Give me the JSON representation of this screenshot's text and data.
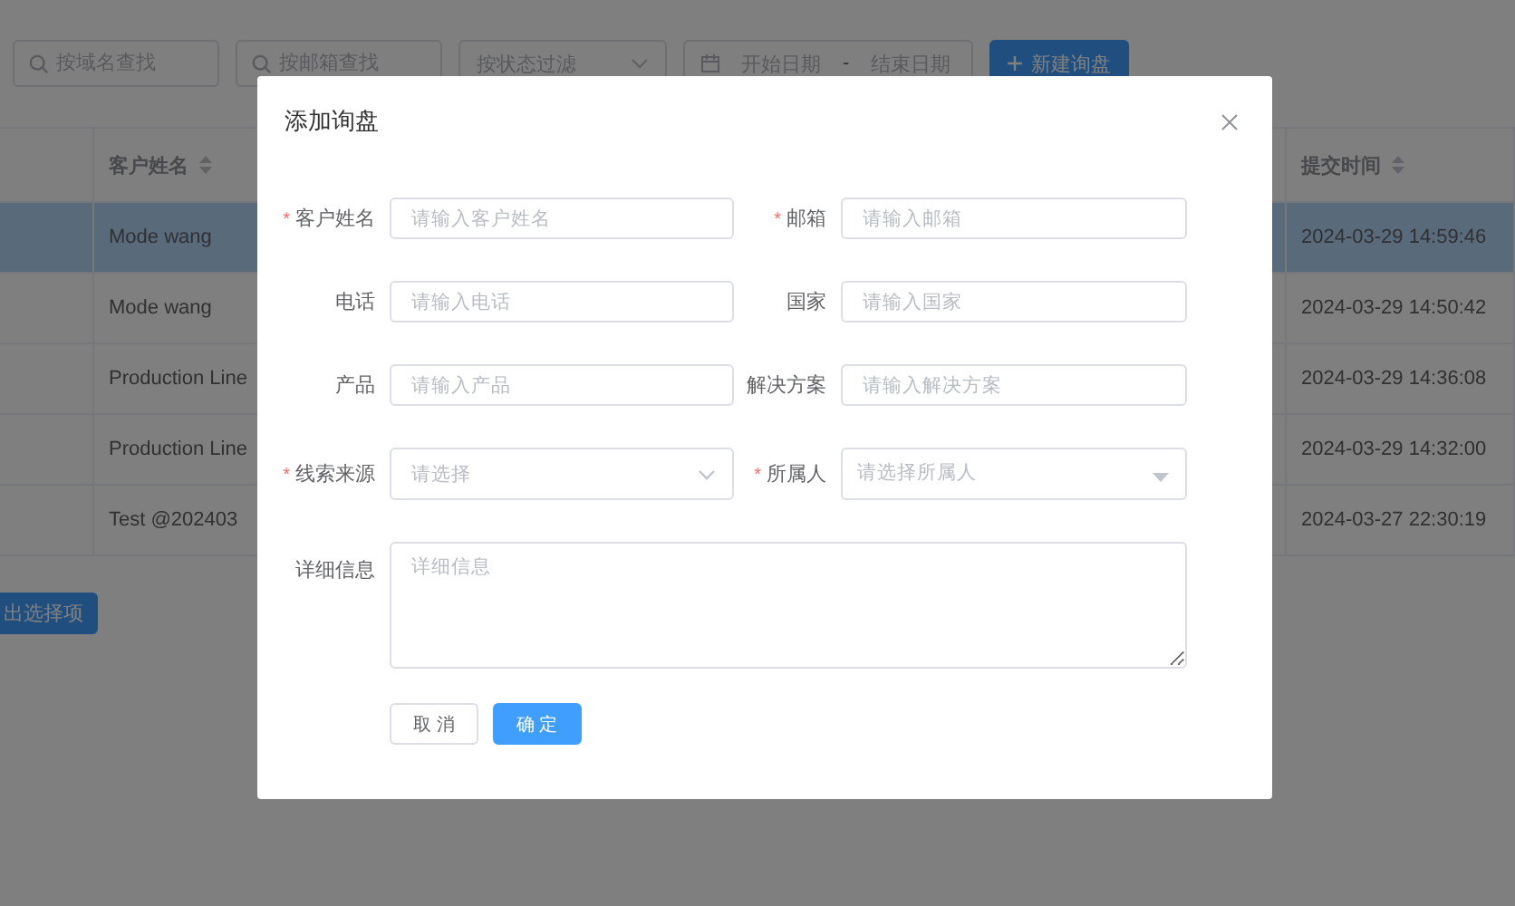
{
  "filters": [
    {
      "kind": "search",
      "placeholder": "按域名查找"
    },
    {
      "kind": "search",
      "placeholder": "按邮箱查找"
    },
    {
      "kind": "select",
      "placeholder": "按状态过滤"
    },
    {
      "kind": "daterange",
      "start_placeholder": "开始日期",
      "separator": "-",
      "end_placeholder": "结束日期"
    },
    {
      "kind": "button",
      "label": "新建询盘"
    }
  ],
  "table": {
    "columns": [
      {
        "label": "客户姓名"
      },
      {
        "label": "提交时间"
      }
    ],
    "rows": [
      {
        "name": "Mode wang",
        "time": "2024-03-29 14:59:46",
        "selected": true
      },
      {
        "name": "Mode wang",
        "time": "2024-03-29 14:50:42",
        "selected": false
      },
      {
        "name": "Production Line",
        "time": "2024-03-29 14:36:08",
        "selected": false
      },
      {
        "name": "Production Line",
        "time": "2024-03-29 14:32:00",
        "selected": false
      },
      {
        "name": "Test @202403",
        "time": "2024-03-27 22:30:19",
        "selected": false
      }
    ]
  },
  "export_button": "出选择项",
  "dialog": {
    "title": "添加询盘",
    "fields": [
      {
        "label": "客户姓名",
        "required_mark": "*",
        "kind": "input",
        "placeholder": "请输入客户姓名"
      },
      {
        "label": "邮箱",
        "required_mark": "*",
        "kind": "input",
        "placeholder": "请输入邮箱"
      },
      {
        "label": "电话",
        "kind": "input",
        "placeholder": "请输入电话"
      },
      {
        "label": "国家",
        "kind": "input",
        "placeholder": "请输入国家"
      },
      {
        "label": "产品",
        "kind": "input",
        "placeholder": "请输入产品"
      },
      {
        "label": "解决方案",
        "kind": "input",
        "placeholder": "请输入解决方案"
      },
      {
        "label": "线索来源",
        "required_mark": "*",
        "kind": "select",
        "placeholder": "请选择"
      },
      {
        "label": "所属人",
        "required_mark": "*",
        "kind": "dropdown",
        "placeholder": "请选择所属人"
      },
      {
        "label": "详细信息",
        "kind": "textarea",
        "placeholder": "详细信息"
      }
    ],
    "buttons": [
      {
        "label": "取 消",
        "kind": "default"
      },
      {
        "label": "确 定",
        "kind": "primary"
      }
    ]
  }
}
